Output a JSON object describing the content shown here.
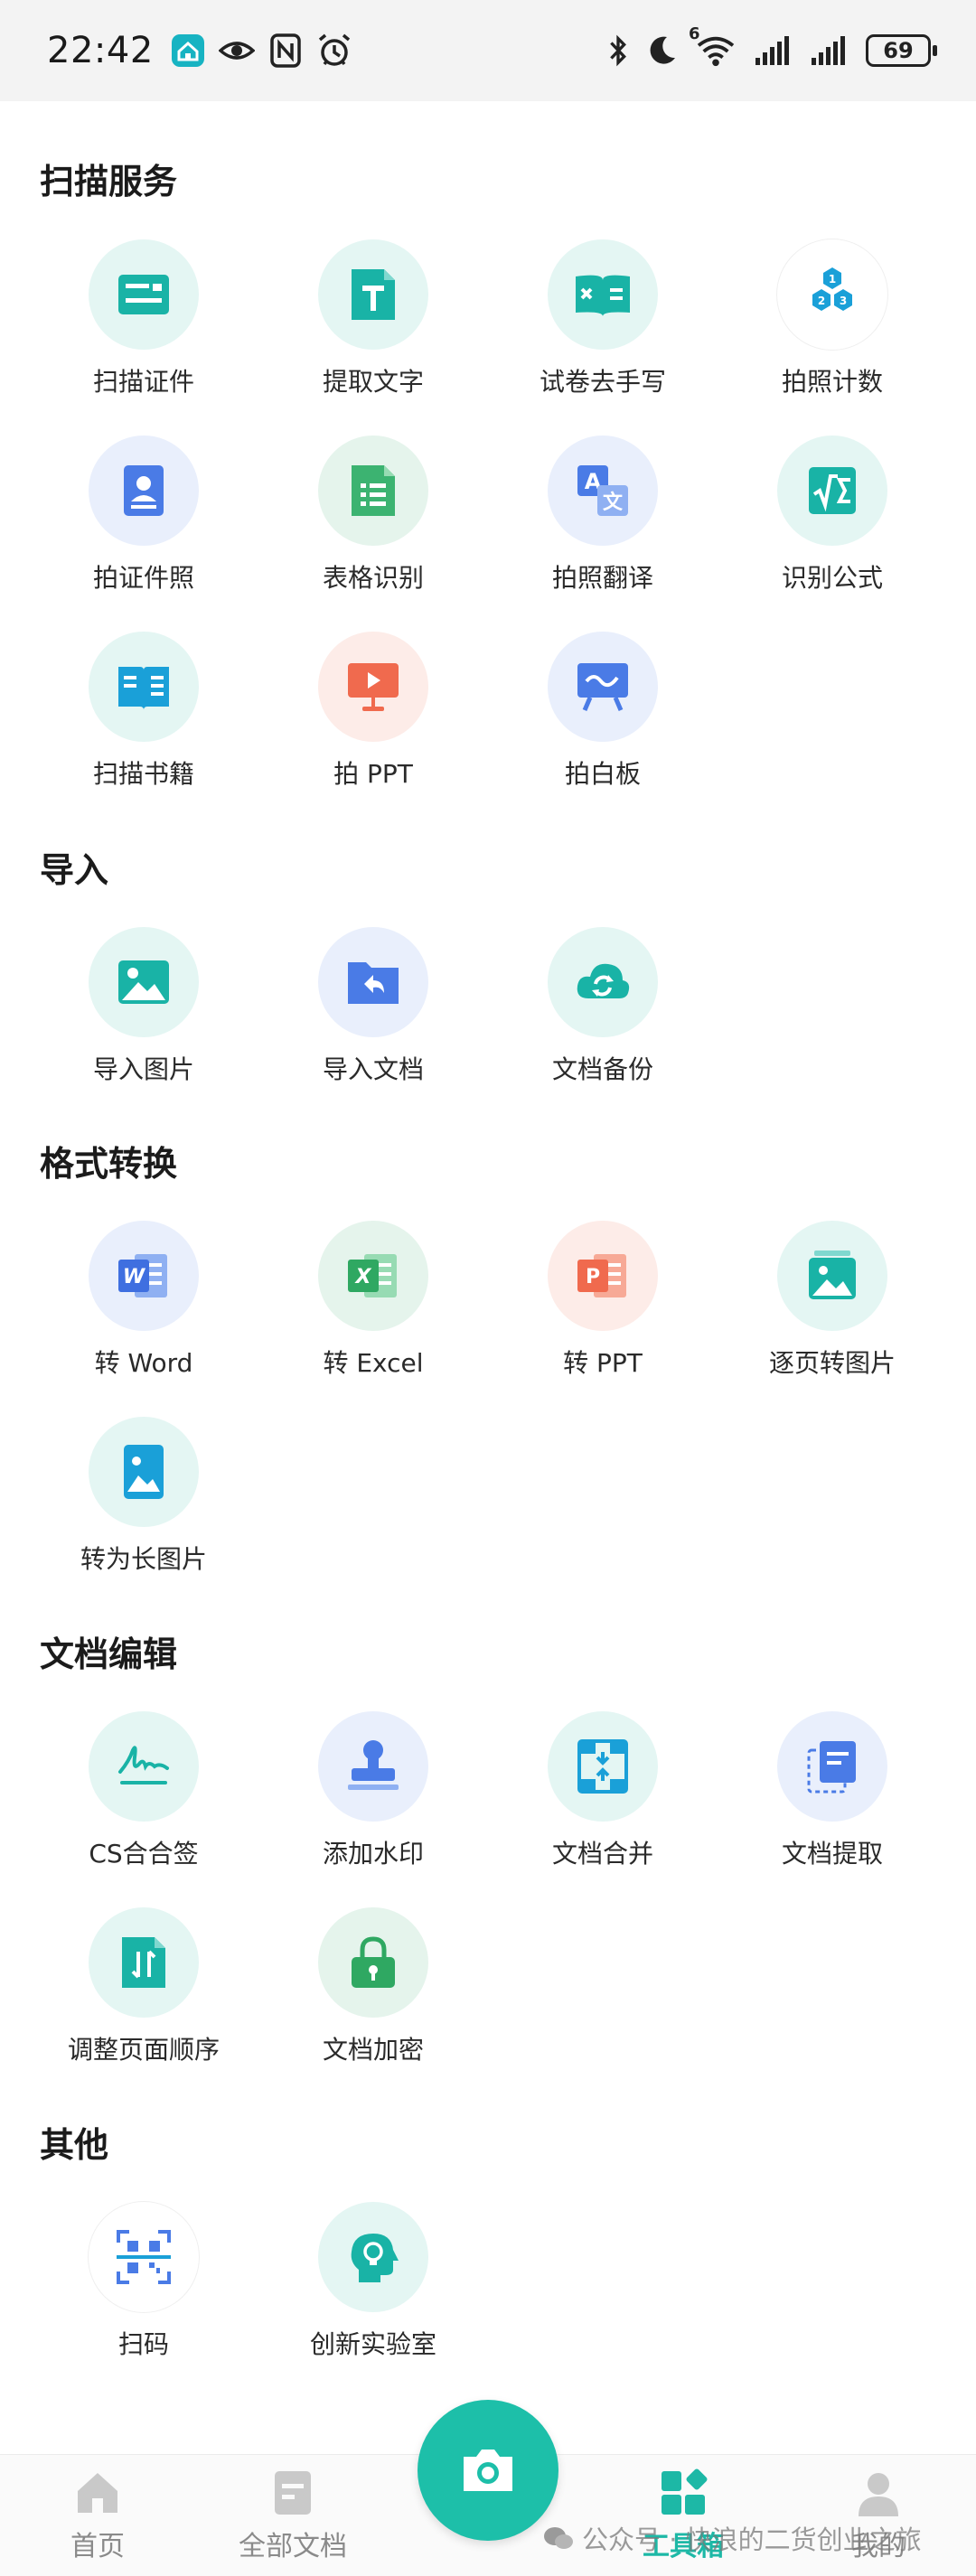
{
  "status_bar": {
    "time": "22:42",
    "network_badge": "6",
    "battery": "69",
    "left_icons": [
      "home-app-icon",
      "eye-icon",
      "nfc-icon",
      "alarm-icon"
    ],
    "right_icons": [
      "bluetooth-icon",
      "moon-icon",
      "wifi-icon",
      "signal-icon",
      "signal-icon"
    ]
  },
  "sections": {
    "scan": {
      "title": "扫描服务",
      "items": [
        "扫描证件",
        "提取文字",
        "试卷去手写",
        "拍照计数",
        "拍证件照",
        "表格识别",
        "拍照翻译",
        "识别公式",
        "扫描书籍",
        "拍 PPT",
        "拍白板"
      ]
    },
    "import": {
      "title": "导入",
      "items": [
        "导入图片",
        "导入文档",
        "文档备份"
      ]
    },
    "convert": {
      "title": "格式转换",
      "items": [
        "转 Word",
        "转 Excel",
        "转 PPT",
        "逐页转图片",
        "转为长图片"
      ]
    },
    "edit": {
      "title": "文档编辑",
      "items": [
        "CS合合签",
        "添加水印",
        "文档合并",
        "文档提取",
        "调整页面顺序",
        "文档加密"
      ]
    },
    "other": {
      "title": "其他",
      "items": [
        "扫码",
        "创新实验室"
      ]
    }
  },
  "bottom_nav": {
    "home": "首页",
    "all_docs": "全部文档",
    "toolbox": "工具箱",
    "mine": "我的",
    "active": "toolbox"
  },
  "watermark": "公众号 · 快浪的二货创业之旅",
  "colors": {
    "accent": "#1db8a6",
    "teal_bg": "#e4f6f3",
    "blue_bg": "#e9effc",
    "red_bg": "#fdece8",
    "green_bg": "#e5f4ec",
    "icon_teal": "#19b3a6",
    "icon_blue": "#4a7be6",
    "icon_red": "#f06a4e",
    "icon_green": "#3cb371"
  }
}
